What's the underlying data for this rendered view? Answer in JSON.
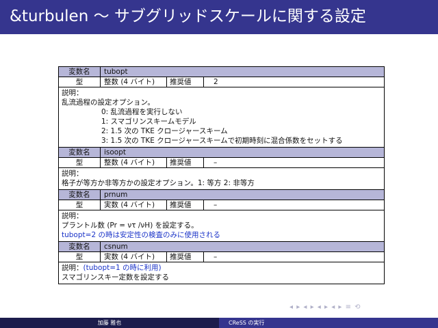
{
  "slide": {
    "title": "&turbulen 〜 サブグリッドスケールに関する設定"
  },
  "labels": {
    "var_name": "変数名",
    "type": "型",
    "recommended": "推奨値"
  },
  "variables": [
    {
      "name": "tubopt",
      "type": "整数 (4 バイト)",
      "recommended": "2",
      "desc_lines": [
        "説明：",
        "乱流過程の設定オプション。",
        "0: 乱流過程を実行しない",
        "1: スマゴリンスキームモデル",
        "2: 1.5 次の TKE クロージャースキーム",
        "3: 1.5 次の TKE クロージャースキームで初期時刻に混合係数をセットする"
      ]
    },
    {
      "name": "isoopt",
      "type": "整数 (4 バイト)",
      "recommended": "–",
      "desc_lines": [
        "説明：",
        "格子が等方か非等方かの設定オプション。1: 等方 2: 非等方"
      ]
    },
    {
      "name": "prnum",
      "type": "実数 (4 バイト)",
      "recommended": "–",
      "desc_lines": [
        "説明：",
        "プラントル数 (Pr = ντ /νH) を設定する。",
        "tubopt=2 の時は安定性の検査のみに使用される"
      ]
    },
    {
      "name": "csnum",
      "type": "実数 (4 バイト)",
      "recommended": "–",
      "desc_lines": [
        "説明：(tubopt=1 の時に利用)",
        "スマゴリンスキー定数を設定する"
      ]
    }
  ],
  "footer": {
    "author": "加藤 雅也",
    "talk": "CReSS の実行"
  },
  "nav": {
    "symbols": "◂ ▸ ◂ ▸ ◂ ▸ ◂ ▸ ≡ ⟲"
  },
  "colors": {
    "title_bar": "#35358e",
    "header_row": "#b6b6d8",
    "highlight_text": "#1a33c8",
    "footer_left": "#1c1c4c",
    "footer_right": "#35358e"
  }
}
